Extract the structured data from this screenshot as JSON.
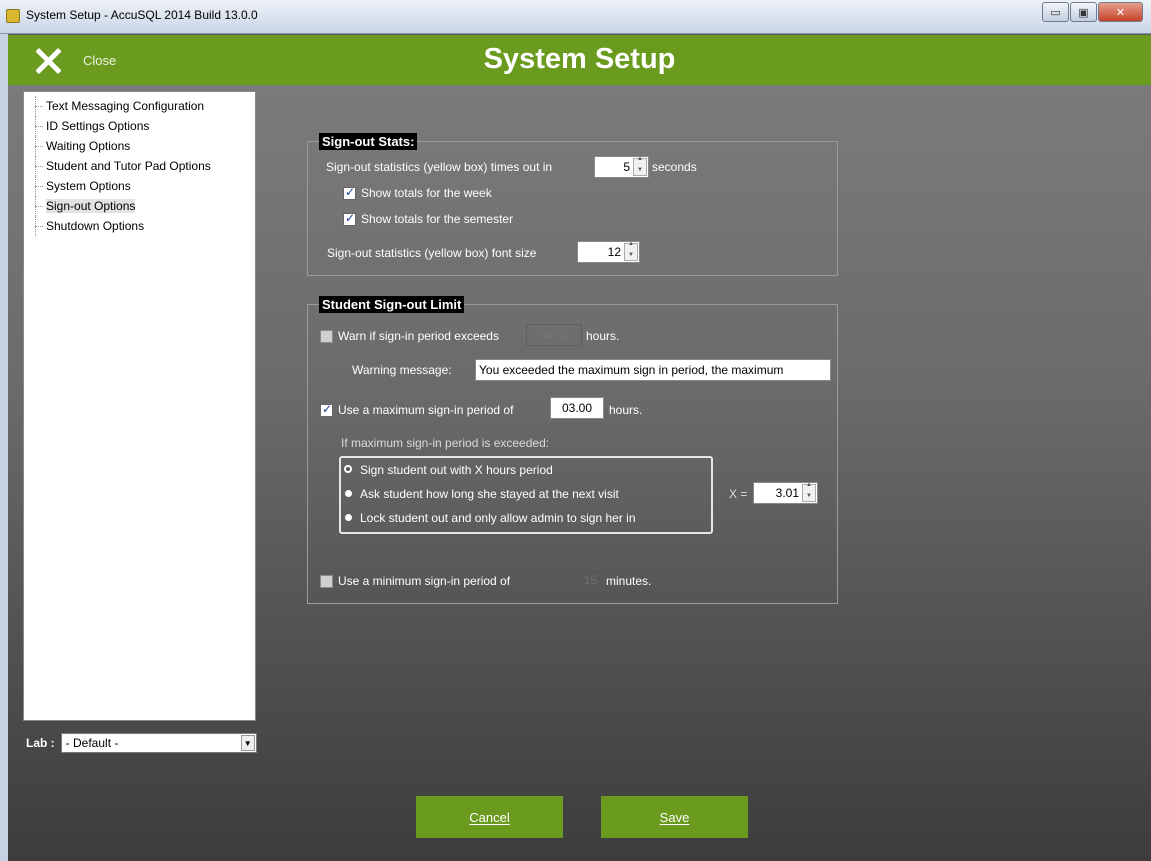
{
  "window": {
    "title": "System Setup - AccuSQL 2014 Build 13.0.0",
    "minimize_glyph": "▭",
    "maximize_glyph": "▣",
    "close_glyph": "✕"
  },
  "header": {
    "close_label": "Close",
    "title": "System Setup"
  },
  "sidebar": {
    "items": [
      {
        "label": "Text Messaging Configuration"
      },
      {
        "label": "ID Settings Options"
      },
      {
        "label": "Waiting Options"
      },
      {
        "label": "Student and Tutor Pad Options"
      },
      {
        "label": "System Options"
      },
      {
        "label": "Sign-out Options"
      },
      {
        "label": "Shutdown Options"
      }
    ],
    "selected": "Sign-out Options",
    "lab_label": "Lab :",
    "lab_value": "- Default -"
  },
  "signout_stats": {
    "title": "Sign-out Stats:",
    "timeout_label": "Sign-out statistics (yellow box) times out in",
    "timeout_value": "5",
    "timeout_unit": "seconds",
    "week_label": "Show totals for the week",
    "week_checked": true,
    "semester_label": "Show totals for the semester",
    "semester_checked": true,
    "font_label": "Sign-out statistics (yellow box) font size",
    "font_value": "12"
  },
  "limit": {
    "title": "Student Sign-out Limit",
    "warn_label": "Warn if sign-in period exceeds",
    "warn_value": "04:00",
    "warn_unit": "hours.",
    "warn_checked": false,
    "warning_msg_label": "Warning message:",
    "warning_msg_value": "You exceeded the maximum sign in period, the maximum",
    "max_label": "Use a maximum sign-in period of",
    "max_value": "03.00",
    "max_unit": "hours.",
    "max_checked": true,
    "exceeded_label": "If maximum sign-in period is exceeded:",
    "options": [
      {
        "label": "Sign student out with X hours period",
        "selected": true
      },
      {
        "label": "Ask student how long she stayed at the next visit",
        "selected": false
      },
      {
        "label": "Lock student out and only allow admin to sign her in",
        "selected": false
      }
    ],
    "x_label": "X =",
    "x_value": "3.01",
    "min_label": "Use a minimum sign-in period of",
    "min_value": "15",
    "min_unit": "minutes.",
    "min_checked": false
  },
  "buttons": {
    "cancel": "Cancel",
    "save": "Save"
  }
}
